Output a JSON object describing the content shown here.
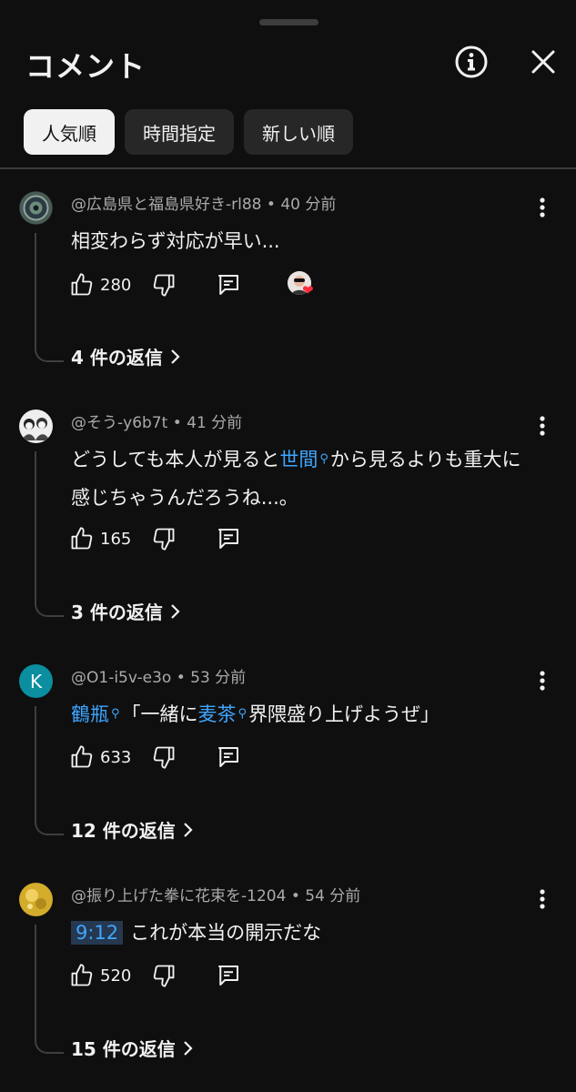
{
  "header": {
    "title": "コメント",
    "info_icon": "info-icon",
    "close_icon": "close-icon"
  },
  "chips": [
    {
      "label": "人気順",
      "active": true
    },
    {
      "label": "時間指定",
      "active": false
    },
    {
      "label": "新しい順",
      "active": false
    }
  ],
  "comments": [
    {
      "author": "@広島県と福島県好き-rl88",
      "time": "40 分前",
      "text": "相変わらず対応が早い...",
      "likes": "280",
      "creator_heart": true,
      "replies_label": "4 件の返信"
    },
    {
      "author": "@そう-y6b7t",
      "time": "41 分前",
      "text_parts": [
        "どうしても本人が見ると",
        "世間",
        "から見るよりも重大に感じちゃうんだろうね...。"
      ],
      "likes": "165",
      "replies_label": "3 件の返信"
    },
    {
      "author": "@O1-i5v-e3o",
      "time": "53 分前",
      "avatar_letter": "K",
      "text_parts": [
        "鶴瓶",
        "「一緒に",
        "麦茶",
        "界隈盛り上げようぜ」"
      ],
      "likes": "633",
      "replies_label": "12 件の返信"
    },
    {
      "author": "@振り上げた拳に花束を-1204",
      "time": "54 分前",
      "timestamp": "9:12",
      "text": "これが本当の開示だな",
      "likes": "520",
      "replies_label": "15 件の返信"
    }
  ],
  "colors": {
    "background": "#0f0f0f",
    "link": "#3ea6ff",
    "secondary_text": "#aaaaaa",
    "chip_bg": "#272727",
    "avatar_teal": "#0a8ea0",
    "heart": "#ff2b3d"
  },
  "separator": "•"
}
